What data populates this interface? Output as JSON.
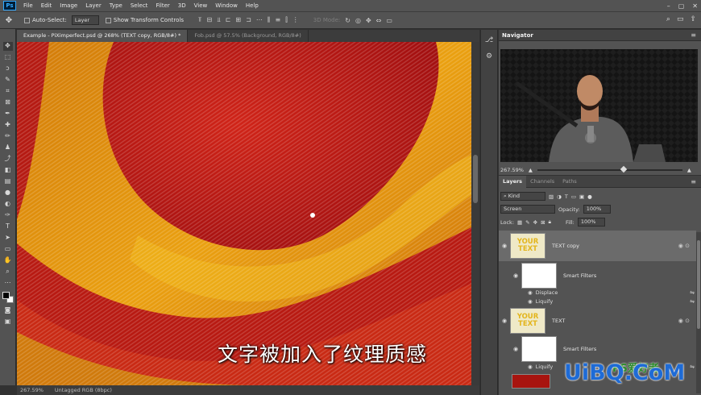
{
  "app": {
    "logo": "Ps"
  },
  "menu": [
    "File",
    "Edit",
    "Image",
    "Layer",
    "Type",
    "Select",
    "Filter",
    "3D",
    "View",
    "Window",
    "Help"
  ],
  "options": {
    "auto_select_label": "Auto-Select:",
    "auto_select_value": "Layer",
    "transform_controls_label": "Show Transform Controls",
    "mode_3d_label": "3D Mode:"
  },
  "documents": {
    "tabs": [
      {
        "label": "Example - PiXimperfect.psd @ 268% (TEXT copy, RGB/8#) *"
      },
      {
        "label": "Fob.psd @ 57.5% (Background, RGB/8#)"
      }
    ],
    "subtitle": "文字被加入了纹理质感"
  },
  "status": {
    "zoom": "267.59%",
    "profile": "Untagged RGB (8bpc)"
  },
  "navigator": {
    "title": "Navigator",
    "zoom": "267.59%",
    "zoom_fraction": 0.6
  },
  "layers_panel": {
    "tabs": [
      "Layers",
      "Channels",
      "Paths"
    ],
    "filter_label": "Kind",
    "blend_mode": "Screen",
    "opacity_label": "Opacity:",
    "opacity_value": "100%",
    "lock_label": "Lock:",
    "fill_label": "Fill:",
    "fill_value": "100%",
    "thumb_text_line1": "YOUR",
    "thumb_text_line2": "TEXT",
    "layers": [
      {
        "name": "TEXT copy",
        "smart_filters": "Smart Filters",
        "filters": [
          "Displace",
          "Liquify"
        ]
      },
      {
        "name": "TEXT",
        "smart_filters": "Smart Filters",
        "filters": [
          "Liquify"
        ]
      }
    ]
  },
  "watermark": {
    "text": "UiBQ.CoM",
    "top_text": "PS爱好者"
  },
  "colors": {
    "accent": "#31a8ff",
    "panel": "#535353",
    "dark": "#323232",
    "yellow": "#e3b51c"
  }
}
